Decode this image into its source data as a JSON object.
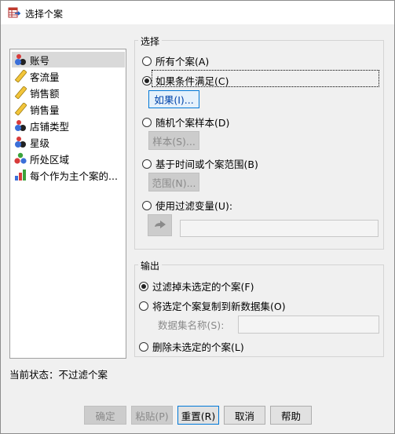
{
  "window": {
    "title": "选择个案"
  },
  "variables": [
    {
      "label": "账号",
      "icon": "nominal-icon",
      "selected": true
    },
    {
      "label": "客流量",
      "icon": "scale-icon",
      "selected": false
    },
    {
      "label": "销售额",
      "icon": "scale-icon",
      "selected": false
    },
    {
      "label": "销售量",
      "icon": "scale-icon",
      "selected": false
    },
    {
      "label": "店铺类型",
      "icon": "nominal-icon",
      "selected": false
    },
    {
      "label": "星级",
      "icon": "nominal-icon",
      "selected": false
    },
    {
      "label": "所处区域",
      "icon": "nominal-color-icon",
      "selected": false
    },
    {
      "label": "每个作为主个案的...",
      "icon": "ordinal-icon",
      "selected": false
    }
  ],
  "select_group": {
    "title": "选择",
    "all_cases": "所有个案(A)",
    "if_condition": "如果条件满足(C)",
    "if_button": "如果(I)...",
    "random_sample": "随机个案样本(D)",
    "sample_button": "样本(S)...",
    "time_range": "基于时间或个案范围(B)",
    "range_button": "范围(N)...",
    "filter_var": "使用过滤变量(U):"
  },
  "output_group": {
    "title": "输出",
    "filter_out": "过滤掉未选定的个案(F)",
    "copy_new": "将选定个案复制到新数据集(O)",
    "dataset_label": "数据集名称(S):",
    "delete": "删除未选定的个案(L)"
  },
  "status": {
    "text": "当前状态：不过滤个案"
  },
  "buttons": {
    "ok": "确定",
    "paste": "粘贴(P)",
    "reset": "重置(R)",
    "cancel": "取消",
    "help": "帮助"
  }
}
